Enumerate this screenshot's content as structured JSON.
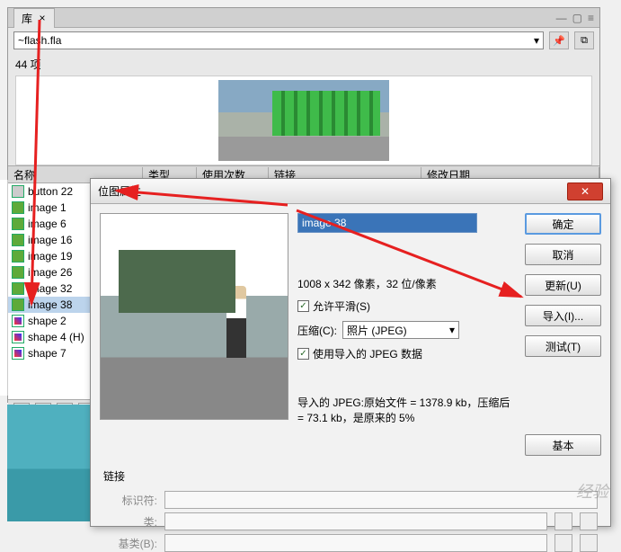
{
  "library": {
    "tab": "库",
    "file": "~flash.fla",
    "count": "44 项",
    "columns": {
      "name": "名称",
      "type": "类型",
      "use": "使用次数",
      "link": "链接",
      "date": "修改日期"
    },
    "items": [
      {
        "label": "button 22",
        "kind": "btn"
      },
      {
        "label": "image 1",
        "kind": "img"
      },
      {
        "label": "image 6",
        "kind": "img"
      },
      {
        "label": "image 16",
        "kind": "img"
      },
      {
        "label": "image 19",
        "kind": "img"
      },
      {
        "label": "image 26",
        "kind": "img"
      },
      {
        "label": "image 32",
        "kind": "img"
      },
      {
        "label": "image 38",
        "kind": "img",
        "selected": true
      },
      {
        "label": "shape 2",
        "kind": "shape"
      },
      {
        "label": "shape 4 (H)",
        "kind": "shape"
      },
      {
        "label": "shape 7",
        "kind": "shape"
      }
    ]
  },
  "dialog": {
    "title": "位图属性",
    "name": "image 38",
    "dimensions": "1008 x 342 像素，32 位/像素",
    "smoothing": "允许平滑(S)",
    "compress_label": "压缩(C):",
    "compress_value": "照片 (JPEG)",
    "use_imported": "使用导入的 JPEG 数据",
    "import_info": "导入的 JPEG:原始文件 = 1378.9 kb，压缩后 = 73.1 kb，是原来的 5%",
    "link_heading": "链接",
    "link_id": "标识符:",
    "link_class": "类:",
    "link_base": "基类(B):",
    "buttons": {
      "ok": "确定",
      "cancel": "取消",
      "update": "更新(U)",
      "import": "导入(I)...",
      "test": "测试(T)",
      "basic": "基本"
    }
  },
  "watermark": "经验"
}
